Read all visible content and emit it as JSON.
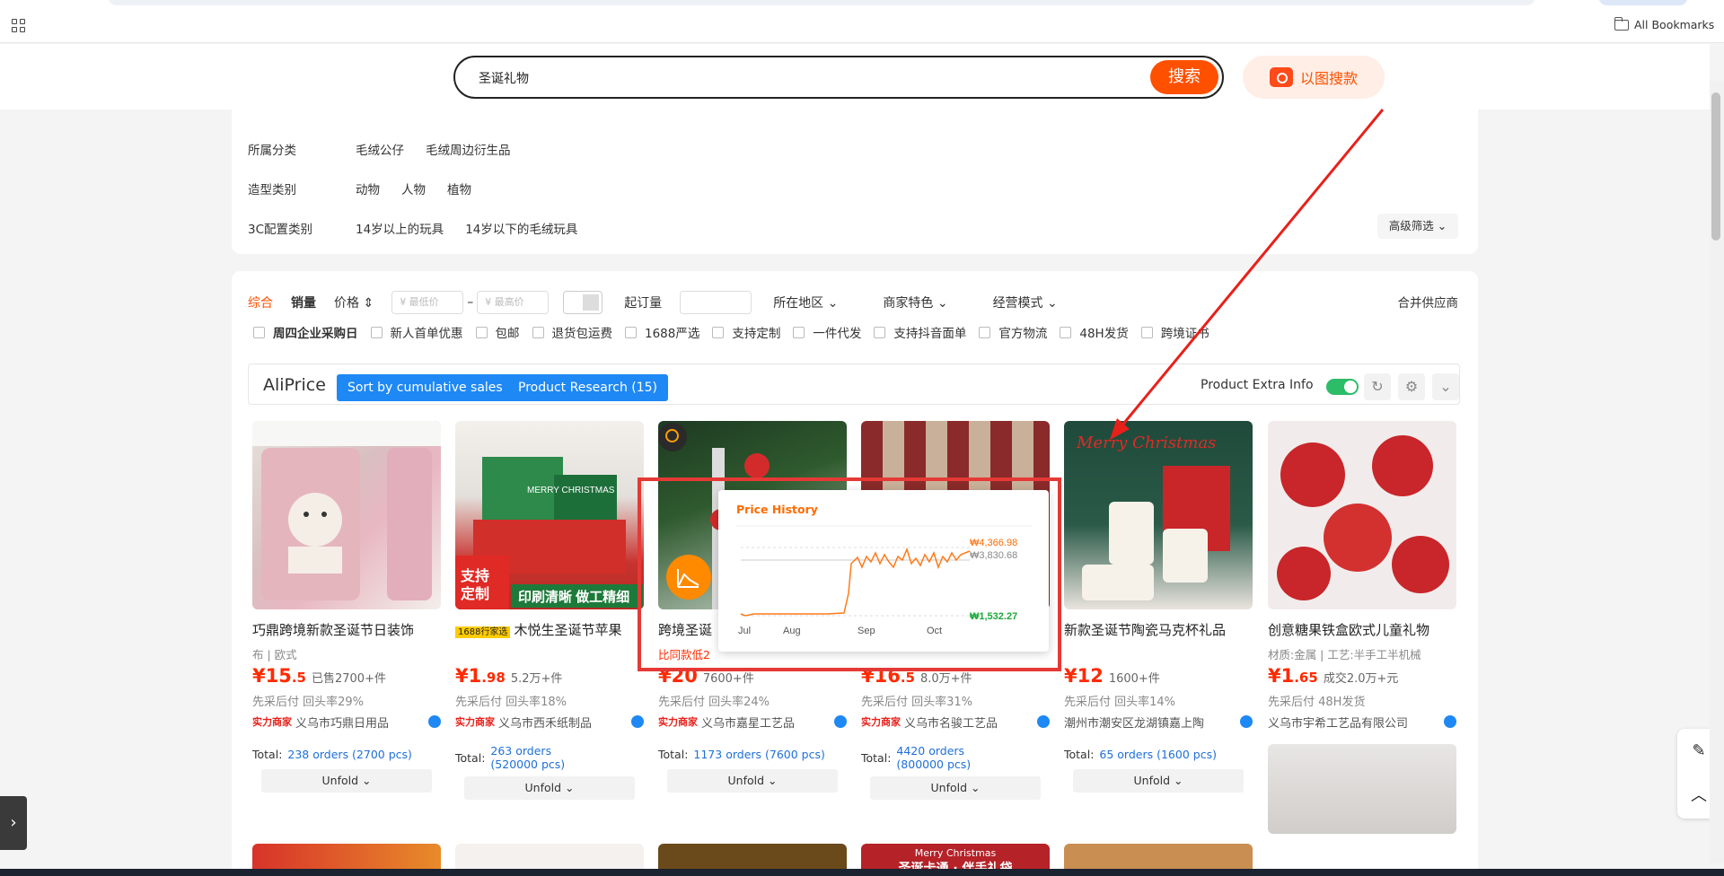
{
  "browser": {
    "bookmarks_label": "All Bookmarks"
  },
  "search": {
    "query": "圣诞礼物",
    "button": "搜索",
    "image_search": "以图搜款"
  },
  "filters": {
    "rows": [
      {
        "label": "所属分类",
        "options": [
          "毛绒公仔",
          "毛绒周边衍生品"
        ]
      },
      {
        "label": "造型类别",
        "options": [
          "动物",
          "人物",
          "植物"
        ]
      },
      {
        "label": "3C配置类别",
        "options": [
          "14岁以上的玩具",
          "14岁以下的毛绒玩具"
        ]
      }
    ],
    "advanced": "高级筛选"
  },
  "sort": {
    "items": [
      "综合",
      "销量",
      "价格"
    ],
    "min_placeholder": "¥ 最低价",
    "max_placeholder": "¥ 最高价",
    "moq_label": "起订量",
    "dropdowns": [
      "所在地区",
      "商家特色",
      "经营模式"
    ],
    "merge": "合并供应商",
    "checks": [
      "周四企业采购日",
      "新人首单优惠",
      "包邮",
      "退货包运费",
      "1688严选",
      "支持定制",
      "一件代发",
      "支持抖音面单",
      "官方物流",
      "48H发货",
      "跨境证书"
    ]
  },
  "aliprice": {
    "logo": "AliPrice",
    "btn_sort": "Sort by cumulative sales",
    "btn_research": "Product Research (15)",
    "extra_info": "Product Extra Info",
    "extra_info_on": true
  },
  "products": [
    {
      "title": "巧鼎跨境新款圣诞节日装饰",
      "tags": "布 | 欧式",
      "price_int": "¥15",
      "price_dec": ".5",
      "sold": "已售2700+件",
      "meta": "先采后付  回头率29%",
      "seller": "义乌市巧鼎日用品",
      "total_label": "Total:",
      "total_link": "238 orders (2700 pcs)",
      "unfold": "Unfold"
    },
    {
      "title": "木悦生圣诞节苹果",
      "badge": "1688行家选",
      "tags": "",
      "price_int": "¥1",
      "price_dec": ".98",
      "sold": "5.2万+件",
      "meta": "先采后付  回头率18%",
      "seller": "义乌市西禾纸制品",
      "total_label": "Total:",
      "total_link": "263 orders (520000 pcs)",
      "unfold": "Unfold"
    },
    {
      "title": "跨境圣诞",
      "tags": "比同款低2",
      "price_int": "¥20",
      "price_dec": "",
      "sold": "7600+件",
      "meta": "先采后付  回头率24%",
      "seller": "义乌市嘉星工艺品",
      "total_label": "Total:",
      "total_link": "1173 orders (7600 pcs)",
      "unfold": "Unfold"
    },
    {
      "title": "",
      "tags": "",
      "price_int": "¥16",
      "price_dec": ".5",
      "sold": "8.0万+件",
      "meta": "先采后付  回头率31%",
      "seller": "义乌市名骏工艺品",
      "total_label": "Total:",
      "total_link": "4420 orders (800000 pcs)",
      "unfold": "Unfold"
    },
    {
      "title": "新款圣诞节陶瓷马克杯礼品",
      "tags": "",
      "price_int": "¥12",
      "price_dec": "",
      "sold": "1600+件",
      "meta": "先采后付  回头率14%",
      "seller": "潮州市潮安区龙湖镇嘉上陶",
      "total_label": "Total:",
      "total_link": "65 orders (1600 pcs)",
      "unfold": "Unfold"
    },
    {
      "title": "创意糖果铁盒欧式儿童礼物",
      "tags": "材质:金属 | 工艺:半手工半机械",
      "price_int": "¥1",
      "price_dec": ".65",
      "sold": "成交2.0万+元",
      "meta": "先采后付  48H发货",
      "seller": "义乌市宇希工艺品有限公司",
      "total_label": "",
      "total_link": "",
      "unfold": ""
    }
  ],
  "seller_badge": "实力商家",
  "price_history": {
    "title": "Price History",
    "labels": {
      "high": "₩4,366.98",
      "mid": "₩3,830.68",
      "low": "₩1,532.27"
    },
    "months": [
      "Jul",
      "Aug",
      "Sep",
      "Oct"
    ]
  },
  "mug_text": "Merry Christmas",
  "img_text_2a": "支持",
  "img_text_2b": "定制",
  "img_text_2c": "印刷清晰 做工精细",
  "img_text_2d": "MERRY CHRISTMAS",
  "bottom_card_text": "Merry Christmas",
  "bottom_card_text2": "圣诞卡通 · 伴手礼袋"
}
